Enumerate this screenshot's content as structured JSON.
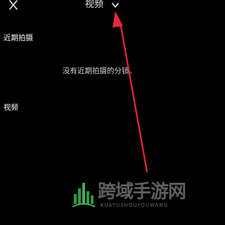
{
  "header": {
    "title": "视频",
    "close_icon": "close-icon",
    "dropdown_icon": "chevron-down-icon"
  },
  "recent": {
    "section_label": "近期拍摄",
    "empty_message": "没有近期拍摄的分镜。"
  },
  "video": {
    "section_label": "视频"
  },
  "watermark": {
    "title": "跨域手游网",
    "subtitle": "KUAYUSHOUYOUWANG"
  },
  "colors": {
    "background": "#000000",
    "annotation_arrow": "#e8283a",
    "watermark_green": "#2f9b45"
  }
}
